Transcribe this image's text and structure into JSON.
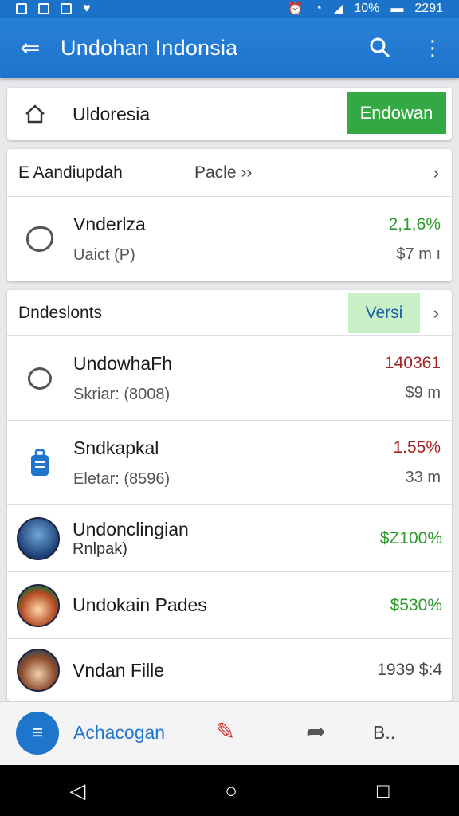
{
  "status": {
    "battery": "10%",
    "time": "2291"
  },
  "appbar": {
    "title": "Undohan Indonsia"
  },
  "top_card": {
    "label": "Uldoresia",
    "button": "Endowan"
  },
  "section1": {
    "title": "E Aandiupdah",
    "subtitle": "Pacle ››",
    "item": {
      "title": "Vnderlza",
      "sub": "Uaict (P)",
      "value": "2,1,6%",
      "value2": "$7 m ı"
    }
  },
  "section2": {
    "title": "Dndeslonts",
    "tab": "Versi",
    "items": [
      {
        "title": "UndowhaFh",
        "sub": "Skriar: (8008)",
        "value": "140361",
        "value2": "$9 m",
        "tone": "neg"
      },
      {
        "title": "Sndkapkal",
        "sub": "Eletar: (8596)",
        "value": "1.55%",
        "value2": "33 m",
        "tone": "neg"
      },
      {
        "title": "Undonclingian",
        "sub": "Rnlpak)",
        "value": "$Z100%",
        "value2": "",
        "tone": "pos"
      },
      {
        "title": "Undokain Pades",
        "sub": "",
        "value": "$530%",
        "value2": "",
        "tone": "pos"
      },
      {
        "title": "Vndan Fille",
        "sub": "",
        "value": "1939 $:4",
        "value2": "",
        "tone": "neutral"
      }
    ]
  },
  "bottomnav": {
    "label": "Achacogan",
    "right": "B.."
  }
}
